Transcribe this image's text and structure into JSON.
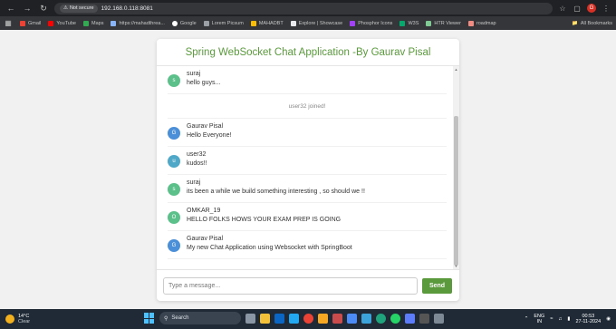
{
  "browser": {
    "url": "192.168.0.118:8081",
    "security_label": "Not secure",
    "profile_initial": "G"
  },
  "bookmarks": {
    "items": [
      {
        "label": "Gmail",
        "color": "#ea4335"
      },
      {
        "label": "YouTube",
        "color": "#ff0000"
      },
      {
        "label": "Maps",
        "color": "#34a853"
      },
      {
        "label": "https://mahadthrea...",
        "color": "#8ab4f8"
      },
      {
        "label": "Google",
        "color": "#ffffff"
      },
      {
        "label": "Lorem Picsum",
        "color": "#9aa0a6"
      },
      {
        "label": "MAHADBT",
        "color": "#fbbc04"
      },
      {
        "label": "Explore | Showcase",
        "color": "#e8eaed"
      },
      {
        "label": "Phosphor Icons",
        "color": "#a142f4"
      },
      {
        "label": "W3S",
        "color": "#04aa6d"
      },
      {
        "label": "HTR Viewer",
        "color": "#81c995"
      },
      {
        "label": "roadmap",
        "color": "#f28b82"
      }
    ],
    "all_label": "All Bookmarks"
  },
  "chat": {
    "title": "Spring WebSocket Chat Application -By Gaurav Pisal",
    "messages": [
      {
        "type": "chat",
        "initial": "s",
        "sender": "suraj",
        "content": "hello guys...",
        "color": "#5cc08a"
      },
      {
        "type": "event",
        "content": "user32 joined!"
      },
      {
        "type": "chat",
        "initial": "G",
        "sender": "Gaurav Pisal",
        "content": "Hello Everyone!",
        "color": "#4a8fd8"
      },
      {
        "type": "chat",
        "initial": "u",
        "sender": "user32",
        "content": "kudos!!",
        "color": "#4fa8c7"
      },
      {
        "type": "chat",
        "initial": "s",
        "sender": "suraj",
        "content": "its been a while we build something interesting , so should we !!",
        "color": "#5cc08a"
      },
      {
        "type": "chat",
        "initial": "O",
        "sender": "OMKAR_19",
        "content": "HELLO FOLKS HOWS YOUR EXAM PREP IS GOING",
        "color": "#5cc08a"
      },
      {
        "type": "chat",
        "initial": "G",
        "sender": "Gaurav Pisal",
        "content": "My new Chat Application using Websocket with SpringBoot",
        "color": "#4a8fd8"
      }
    ],
    "input_placeholder": "Type a message...",
    "send_label": "Send"
  },
  "taskbar": {
    "temperature": "14°C",
    "condition": "Clear",
    "search_placeholder": "Search",
    "language_top": "ENG",
    "language_bottom": "IN",
    "time": "00:53",
    "date": "27-11-2024"
  }
}
